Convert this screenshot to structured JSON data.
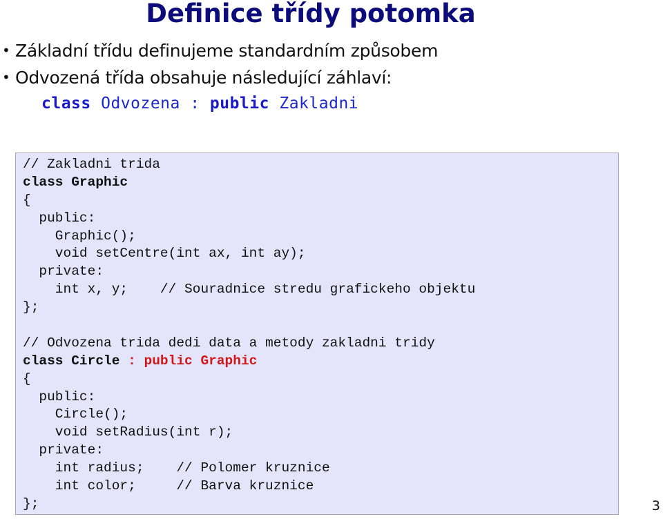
{
  "slide": {
    "title": "Definice třídy potomka",
    "bullets": [
      "Základní třídu definujeme standardním způsobem",
      "Odvozená třída obsahuje následující záhlaví:"
    ],
    "bullet_glyph": "•",
    "header_syntax": {
      "kw1": "class",
      "name1": " Odvozena : ",
      "kw2": "public",
      "name2": " Zakladni"
    },
    "code": {
      "lines": [
        {
          "text": "// Zakladni trida"
        },
        {
          "bold": "class Graphic"
        },
        {
          "text": "{"
        },
        {
          "text": "  public:"
        },
        {
          "text": "    Graphic();"
        },
        {
          "text": "    void setCentre(int ax, int ay);"
        },
        {
          "text": "  private:"
        },
        {
          "text": "    int x, y;    // Souradnice stredu grafickeho objektu"
        },
        {
          "text": "};"
        },
        {
          "text": ""
        },
        {
          "text": "// Odvozena trida dedi data a metody zakladni tridy"
        },
        {
          "bold": "class Circle ",
          "red": ": public Graphic"
        },
        {
          "text": "{"
        },
        {
          "text": "  public:"
        },
        {
          "text": "    Circle();"
        },
        {
          "text": "    void setRadius(int r);"
        },
        {
          "text": "  private:"
        },
        {
          "text": "    int radius;    // Polomer kruznice"
        },
        {
          "text": "    int color;     // Barva kruznice"
        },
        {
          "text": "};"
        }
      ]
    },
    "page_number": "3"
  },
  "colors": {
    "title": "#0c0c7a",
    "keyword": "#1a1ac8",
    "code_background": "#e4e4fa",
    "highlight": "#d01818"
  }
}
